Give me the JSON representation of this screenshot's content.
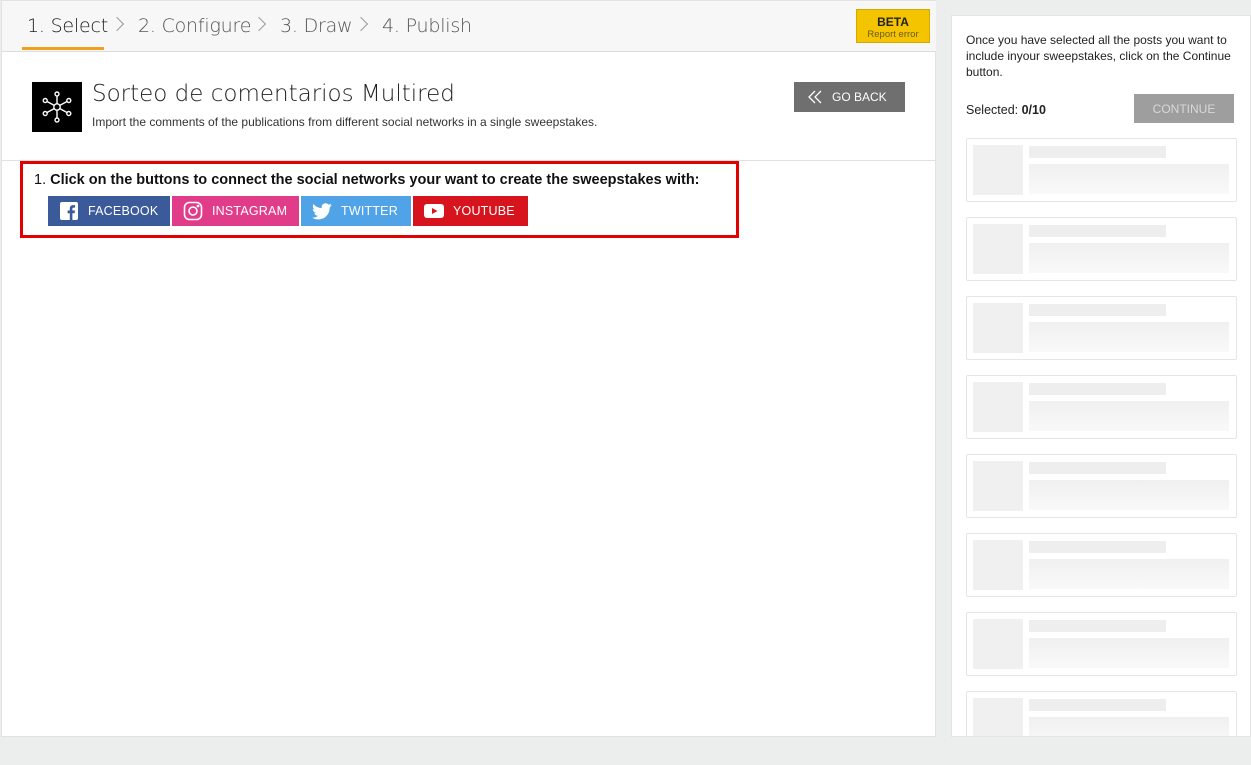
{
  "stepper": {
    "steps": [
      {
        "label": "1. Select",
        "active": true
      },
      {
        "label": "2. Configure",
        "active": false
      },
      {
        "label": "3. Draw",
        "active": false
      },
      {
        "label": "4. Publish",
        "active": false
      }
    ],
    "accent_color": "#f0a020"
  },
  "beta_badge": {
    "title": "BETA",
    "subtitle": "Report error",
    "color": "#f5c400"
  },
  "app": {
    "logo_icon": "network-nodes-icon",
    "title": "Sorteo de comentarios Multired",
    "subtitle": "Import the comments of the publications from different social networks in a single sweepstakes.",
    "go_back_label": "GO BACK"
  },
  "connect": {
    "number": "1.",
    "instruction": "Click on the buttons to connect the social networks your want to create the sweepstakes with:",
    "networks": [
      {
        "label": "FACEBOOK",
        "icon": "facebook-icon",
        "color": "#3b5a9a"
      },
      {
        "label": "INSTAGRAM",
        "icon": "instagram-icon",
        "color": "#e03c8a"
      },
      {
        "label": "TWITTER",
        "icon": "twitter-icon",
        "color": "#4fa3e6"
      },
      {
        "label": "YOUTUBE",
        "icon": "youtube-icon",
        "color": "#d7141d"
      }
    ]
  },
  "side": {
    "info": "Once you have selected all the posts you want to include inyour sweepstakes, click on the Continue button.",
    "selected_label": "Selected:",
    "selected_value": "0/10",
    "continue_label": "CONTINUE"
  }
}
